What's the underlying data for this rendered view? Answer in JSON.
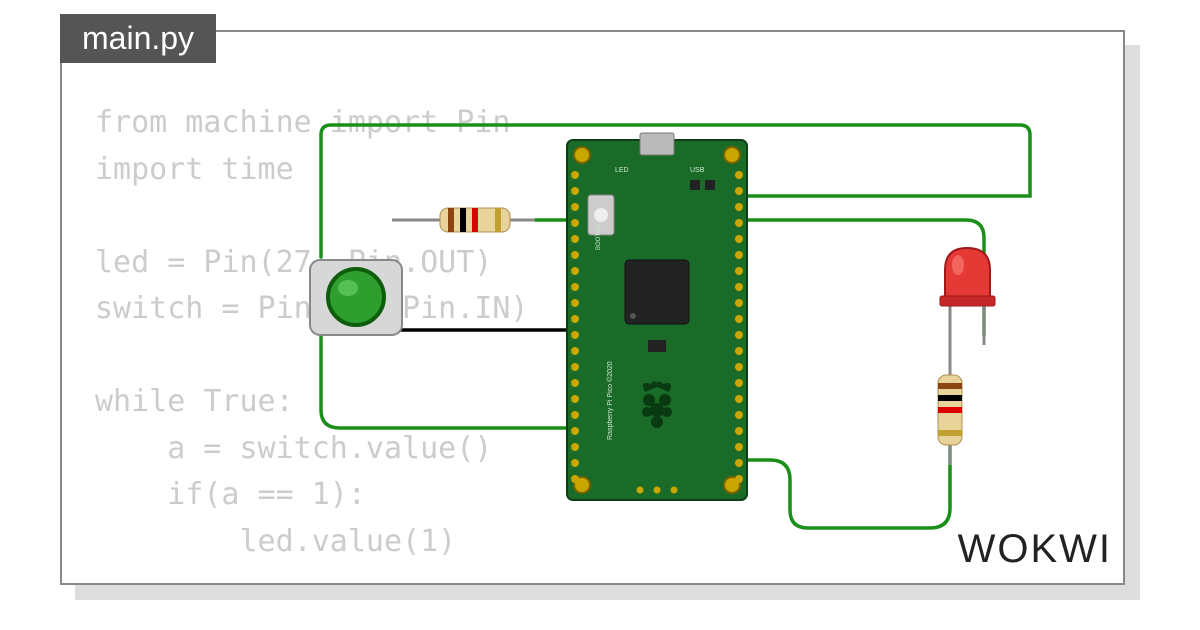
{
  "tab_title": "main.py",
  "code_lines": [
    "from machine import Pin",
    "import time",
    "",
    "led = Pin(27, Pin.OUT)",
    "switch = Pin(11, Pin.IN)",
    "",
    "while True:",
    "    a = switch.value()",
    "    if(a == 1):",
    "        led.value(1)"
  ],
  "brand": "WOKWI",
  "board": {
    "name": "Raspberry Pi Pico",
    "copyright": "©2020",
    "labels": {
      "led": "LED",
      "usb": "USB",
      "bootsel": "BOOTSEL"
    }
  },
  "components": {
    "button": {
      "color": "green"
    },
    "led": {
      "color": "red"
    },
    "resistors": 2
  },
  "colors": {
    "code_text": "#cccccc",
    "wire": "#1a8f1a",
    "wire_gnd": "#000000",
    "pcb": "#1b5e20",
    "pcb_edge": "#0d3d12"
  }
}
